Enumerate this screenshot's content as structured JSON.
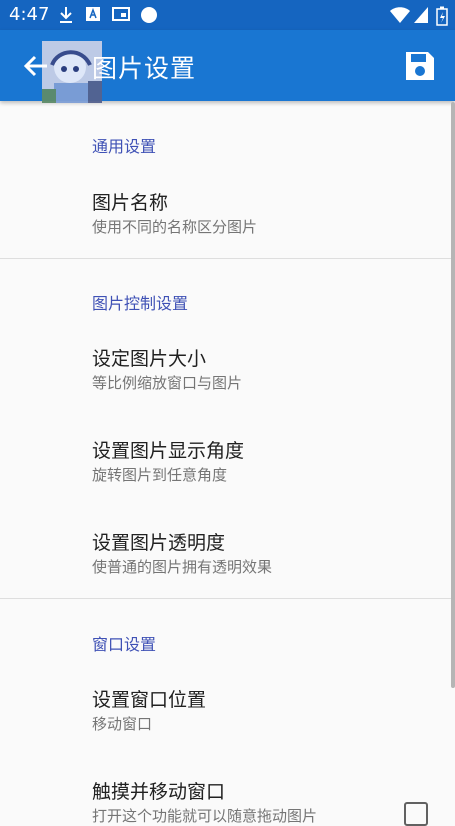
{
  "status_bar": {
    "time": "4:47",
    "left_icons": [
      "download-icon",
      "text-box-icon",
      "cast-icon",
      "circle-icon"
    ],
    "right_icons": [
      "wifi-icon",
      "signal-icon",
      "battery-icon"
    ]
  },
  "app_bar": {
    "title": "图片设置",
    "back_icon": "arrow-back-icon",
    "save_icon": "save-icon",
    "color": "#1976d2"
  },
  "sections": [
    {
      "title": "通用设置",
      "items": [
        {
          "title": "图片名称",
          "subtitle": "使用不同的名称区分图片"
        }
      ]
    },
    {
      "title": "图片控制设置",
      "items": [
        {
          "title": "设定图片大小",
          "subtitle": "等比例缩放窗口与图片"
        },
        {
          "title": "设置图片显示角度",
          "subtitle": "旋转图片到任意角度"
        },
        {
          "title": "设置图片透明度",
          "subtitle": "使普通的图片拥有透明效果"
        }
      ]
    },
    {
      "title": "窗口设置",
      "items": [
        {
          "title": "设置窗口位置",
          "subtitle": "移动窗口"
        },
        {
          "title": "触摸并移动窗口",
          "subtitle": "打开这个功能就可以随意拖动图片"
        }
      ]
    }
  ],
  "accent_color": "#3f51b5"
}
